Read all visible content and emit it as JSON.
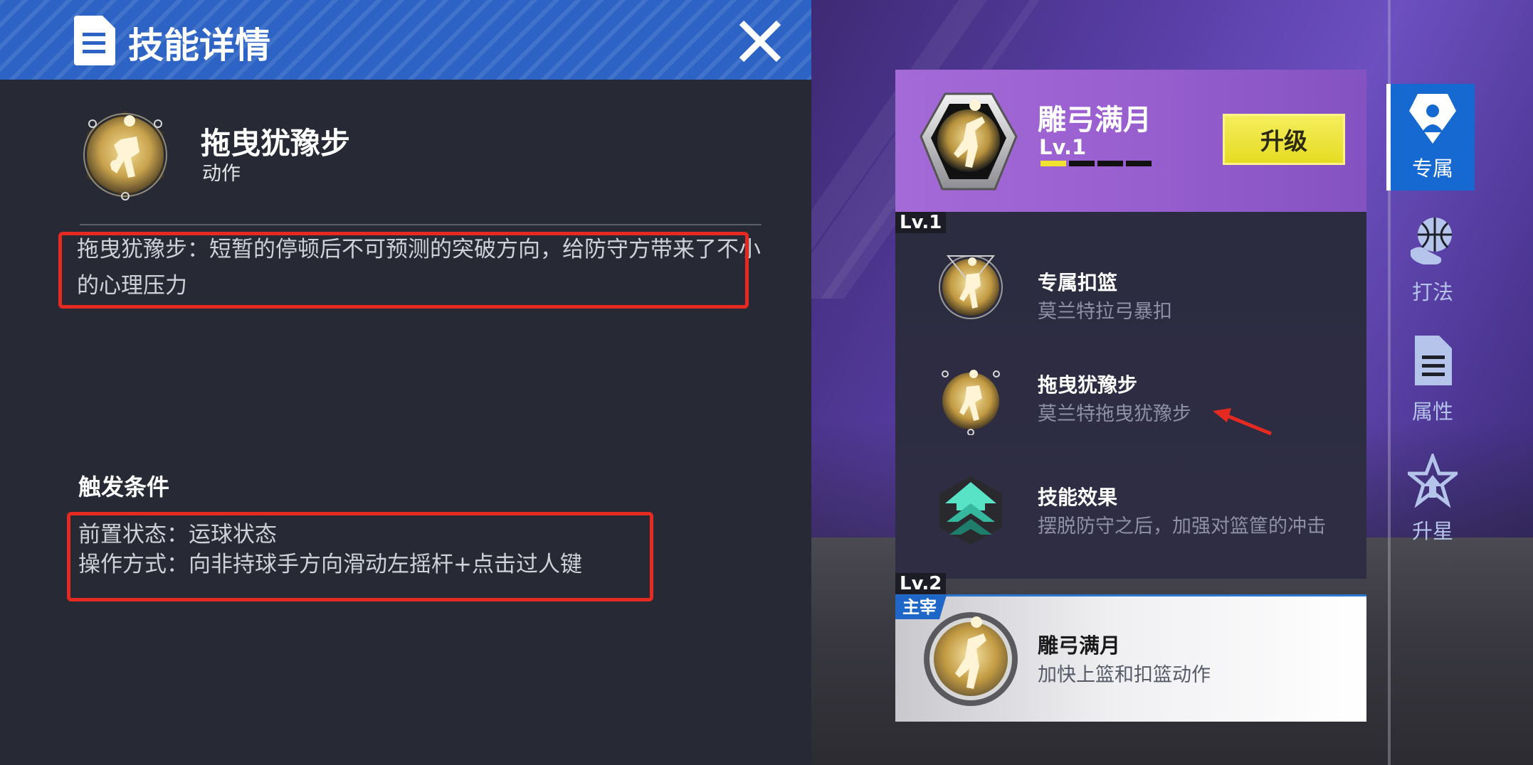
{
  "detail": {
    "title": "技能详情",
    "skill_name": "拖曳犹豫步",
    "skill_type": "动作",
    "description": "拖曳犹豫步：短暂的停顿后不可预测的突破方向，给防守方带来了不小的心理压力",
    "trigger_heading": "触发条件",
    "trigger_pre": "前置状态：运球状态",
    "trigger_op": "操作方式：向非持球手方向滑动左摇杆+点击过人键",
    "icons": {
      "header": "document-icon",
      "close": "close-icon"
    }
  },
  "card": {
    "main_skill": {
      "name": "雕弓满月",
      "level": "Lv.1",
      "level_filled": 1,
      "level_total": 4
    },
    "upgrade_label": "升级",
    "lvl1_tag": "Lv.1",
    "lvl2_tag": "Lv.2",
    "rows": [
      {
        "title": "专属扣篮",
        "desc": "莫兰特拉弓暴扣",
        "icon": "dunk-emblem-icon"
      },
      {
        "title": "拖曳犹豫步",
        "desc": "莫兰特拖曳犹豫步",
        "icon": "dribble-emblem-icon"
      },
      {
        "title": "技能效果",
        "desc": "摆脱防守之后，加强对篮筐的冲击",
        "icon": "boost-chevron-icon"
      }
    ],
    "bottom": {
      "tag": "主宰",
      "name": "雕弓满月",
      "desc": "加快上篮和扣篮动作"
    }
  },
  "side_nav": [
    {
      "label": "专属",
      "icon": "player-badge-icon",
      "active": true
    },
    {
      "label": "打法",
      "icon": "basketball-hand-icon",
      "active": false
    },
    {
      "label": "属性",
      "icon": "document-icon",
      "active": false
    },
    {
      "label": "升星",
      "icon": "star-icon",
      "active": false
    }
  ],
  "colors": {
    "header_blue": "#2c63c4",
    "upgrade_yellow": "#e6dc23",
    "highlight_red": "#e52a22",
    "tab_active": "#1669d0"
  }
}
